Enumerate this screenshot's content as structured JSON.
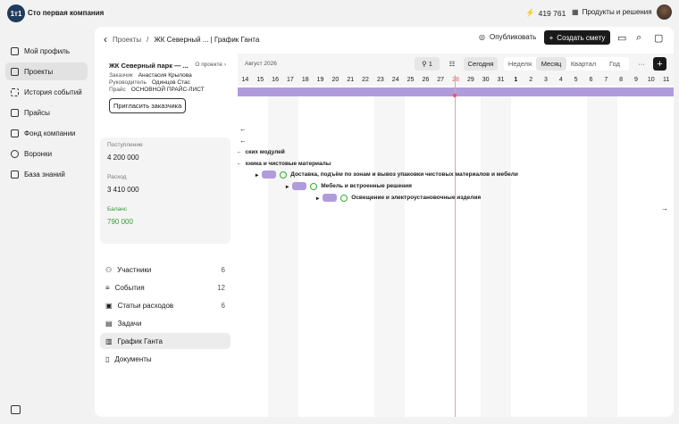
{
  "header": {
    "logo": "1т1",
    "company": "Сто первая компания",
    "balance": "419 761",
    "products": "Продукты и решения"
  },
  "sidebar": {
    "items": [
      {
        "label": "Мой профиль"
      },
      {
        "label": "Проекты"
      },
      {
        "label": "История событий"
      },
      {
        "label": "Прайсы"
      },
      {
        "label": "Фонд компании"
      },
      {
        "label": "Воронки"
      },
      {
        "label": "База знаний"
      }
    ]
  },
  "topbar": {
    "breadcrumb_root": "Проекты",
    "breadcrumb_sep": "/",
    "breadcrumb_current": "ЖК Северный ... | График Ганта",
    "publish": "Опубликовать",
    "create": "Создать смету"
  },
  "project": {
    "title": "ЖК Северный парк — ...",
    "about": "О проекте",
    "client_label": "Заказчик",
    "client": "Анастасия Крылова",
    "manager_label": "Руководитель",
    "manager": "Одинцов Стас",
    "price_label": "Прайс",
    "price": "ОСНОВНОЙ ПРАЙС-ЛИСТ",
    "invite": "Пригласить заказчика"
  },
  "finance": {
    "income_label": "Поступление",
    "income": "4 200 000",
    "expense_label": "Расход",
    "expense": "3 410 000",
    "balance_label": "Баланс",
    "balance": "790 000",
    "balance_color": "#3a9a3a"
  },
  "menu": [
    {
      "label": "Участники",
      "count": "6"
    },
    {
      "label": "События",
      "count": "12"
    },
    {
      "label": "Статьи расходов",
      "count": "6"
    },
    {
      "label": "Задачи",
      "count": ""
    },
    {
      "label": "График Ганта",
      "count": ""
    },
    {
      "label": "Документы",
      "count": ""
    }
  ],
  "gantt": {
    "month": "Август 2026",
    "filter_count": "1",
    "today": "Сегодня",
    "scales": [
      "Неделя",
      "Месяц",
      "Квартал",
      "Год"
    ],
    "active_scale": "Месяц",
    "days": [
      "14",
      "15",
      "16",
      "17",
      "18",
      "19",
      "20",
      "21",
      "22",
      "23",
      "24",
      "25",
      "26",
      "27",
      "28",
      "29",
      "30",
      "31",
      "1",
      "2",
      "3",
      "4",
      "5",
      "6",
      "7",
      "8",
      "9",
      "10",
      "11"
    ],
    "today_day": "28",
    "rows": [
      {
        "label": "ских модулей"
      },
      {
        "label": "хника и чистовые материалы"
      },
      {
        "label": "Доставка, подъём по зонам и вывоз упаковки чистовых материалов и мебели"
      },
      {
        "label": "Мебель и встроенные решения"
      },
      {
        "label": "Освещение и электроустановочные изделия"
      }
    ]
  }
}
